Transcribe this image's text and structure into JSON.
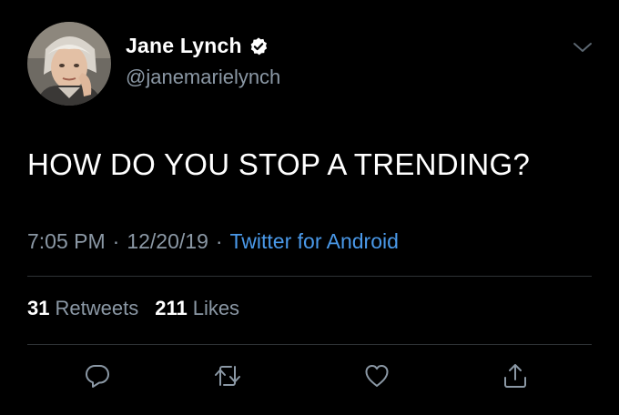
{
  "user": {
    "display_name": "Jane Lynch",
    "handle": "@janemarielynch",
    "verified": true,
    "avatar_icon": "profile-photo"
  },
  "tweet": {
    "text": "HOW DO YOU STOP A TRENDING?"
  },
  "meta": {
    "time": "7:05 PM",
    "separator": "·",
    "date": "12/20/19",
    "source": "Twitter for Android"
  },
  "stats": {
    "retweets_count": "31",
    "retweets_label": "Retweets",
    "likes_count": "211",
    "likes_label": "Likes"
  },
  "actions": {
    "reply_icon": "reply-icon",
    "retweet_icon": "retweet-icon",
    "like_icon": "heart-icon",
    "share_icon": "share-icon"
  },
  "colors": {
    "background": "#000000",
    "text_primary": "#ffffff",
    "text_secondary": "#8b98a5",
    "link": "#4a99e9",
    "divider": "#2f3336"
  }
}
